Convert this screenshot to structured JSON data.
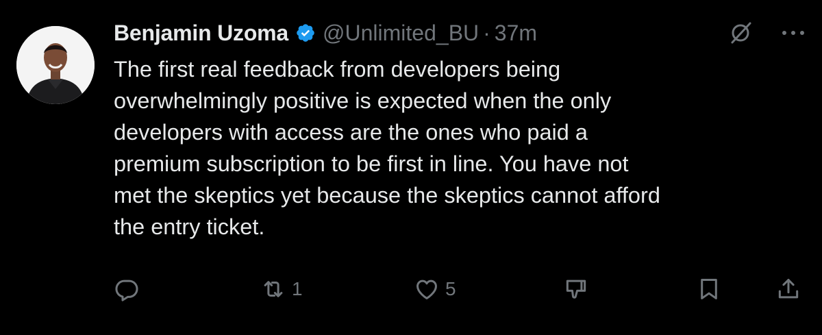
{
  "tweet": {
    "author": {
      "display_name": "Benjamin Uzoma",
      "verified": true,
      "handle": "@Unlimited_BU",
      "separator": "·",
      "time": "37m"
    },
    "text": "The first real feedback from developers being\noverwhelmingly positive is expected when the only\ndevelopers with access are the ones who paid a\npremium subscription to be first in line. You have not\nmet the skeptics yet because the skeptics cannot afford\nthe entry ticket.",
    "actions": {
      "reply_count": "",
      "retweet_count": "1",
      "like_count": "5"
    },
    "icons": {
      "top_right": [
        "grok-icon",
        "more-icon"
      ],
      "action_bar": [
        "reply-icon",
        "retweet-icon",
        "like-icon",
        "downvote-icon",
        "bookmark-icon",
        "share-icon"
      ]
    }
  },
  "colors": {
    "background": "#000000",
    "text_primary": "#e7e9ea",
    "text_secondary": "#71767b",
    "verified_blue": "#1d9bf0"
  }
}
